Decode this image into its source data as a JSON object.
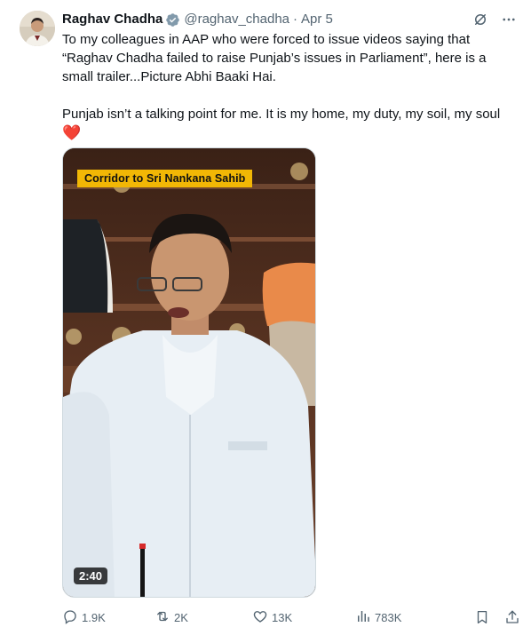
{
  "author": {
    "name": "Raghav Chadha",
    "handle": "@raghav_chadha",
    "date": "Apr 5",
    "separator": "·"
  },
  "post": {
    "line1": "To my colleagues in AAP who were forced to issue videos saying that",
    "line2": "“Raghav Chadha failed to raise Punjab’s issues in Parliament”, here is a",
    "line3": "small trailer...Picture Abhi Baaki Hai.",
    "line4": "Punjab isn’t a talking point for me. It is my home, my duty, my soil, my soul",
    "emoji": "❤️"
  },
  "media": {
    "caption": "Corridor to Sri Nankana Sahib",
    "duration": "2:40"
  },
  "actions": {
    "replies": "1.9K",
    "reposts": "2K",
    "likes": "13K",
    "views": "783K"
  },
  "colors": {
    "text": "#0f1419",
    "secondary": "#536471",
    "verified": "#829aab",
    "caption_bg": "#f2b705",
    "heart": "#e0245e"
  },
  "icons": {
    "verified": "verified-badge-icon",
    "grok": "grok-icon",
    "more": "more-icon",
    "reply": "reply-icon",
    "repost": "repost-icon",
    "like": "like-icon",
    "views": "views-icon",
    "bookmark": "bookmark-icon",
    "share": "share-icon"
  }
}
